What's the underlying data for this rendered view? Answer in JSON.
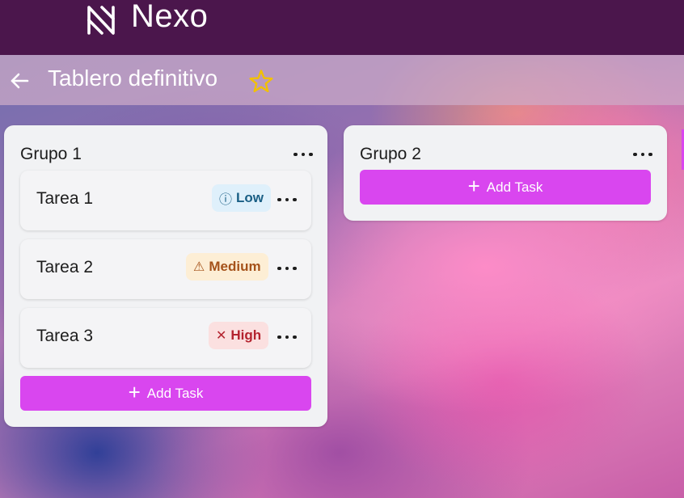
{
  "app": {
    "name": "Nexo",
    "logo_icon": "nexo-logo-icon"
  },
  "board": {
    "title": "Tablero definitivo",
    "back_icon": "arrow-left-icon",
    "star_icon": "star-outline-icon"
  },
  "colors": {
    "topbar": "#4b164c",
    "accent": "#d946ef",
    "star": "#f2c100"
  },
  "columns": [
    {
      "title": "Grupo 1",
      "menu_icon": "more-horizontal-icon",
      "tasks": [
        {
          "title": "Tarea 1",
          "priority": "Low",
          "priority_icon": "ⓘ"
        },
        {
          "title": "Tarea 2",
          "priority": "Medium",
          "priority_icon": "⚠"
        },
        {
          "title": "Tarea 3",
          "priority": "High",
          "priority_icon": "✕"
        }
      ],
      "add_label": "Add Task"
    },
    {
      "title": "Grupo 2",
      "menu_icon": "more-horizontal-icon",
      "tasks": [],
      "add_label": "Add Task"
    }
  ]
}
